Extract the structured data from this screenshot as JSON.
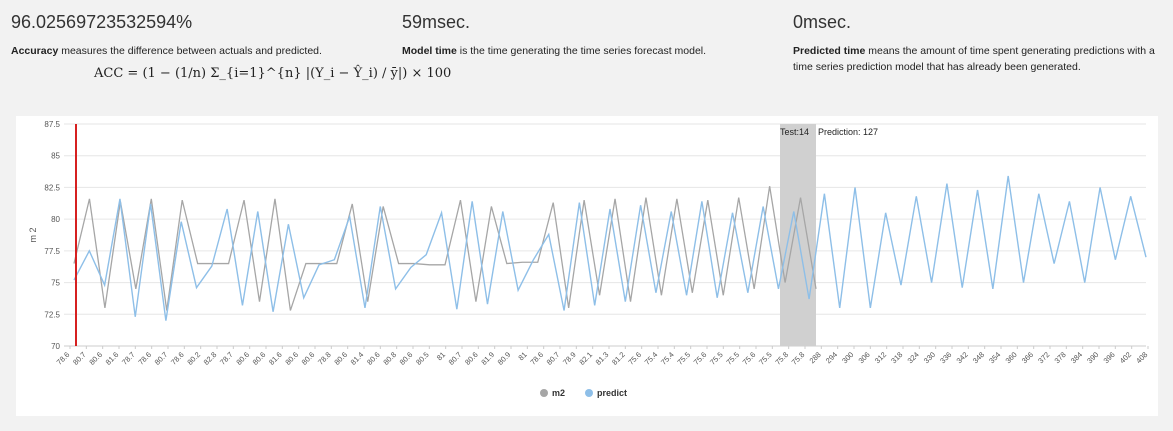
{
  "metrics": {
    "accuracy": {
      "value": "96.02569723532594%",
      "term": "Accuracy",
      "text": " measures the difference between actuals and predicted."
    },
    "model_time": {
      "value": "59msec.",
      "term": "Model time",
      "text": " is the time generating the time series forecast model."
    },
    "predicted_time": {
      "value": "0msec.",
      "term": "Predicted time",
      "text": " means the amount of time spent generating predictions with a time series prediction model that has already been generated."
    }
  },
  "formula": "ACC = (1 − (1/n) Σ_{i=1}^{n} |(Y_i − Ŷ_i) / ȳ|) × 100",
  "colors": {
    "m2": "#a6a6a6",
    "predict": "#8ebfe8",
    "marker": "#d62020",
    "highlight": "#d0d0d0"
  },
  "chart_data": {
    "type": "line",
    "ylabel": "m 2",
    "ylim": [
      70,
      87.5
    ],
    "yticks": [
      "87.5",
      "85",
      "82.5",
      "80",
      "77.5",
      "75",
      "72.5",
      "70"
    ],
    "xtick_labels": [
      "78.6",
      "80.7",
      "80.6",
      "81.6",
      "78.7",
      "78.6",
      "80.7",
      "78.6",
      "80.2",
      "82.8",
      "78.7",
      "80.6",
      "80.6",
      "81.6",
      "80.6",
      "80.6",
      "78.8",
      "80.6",
      "81.4",
      "80.6",
      "80.8",
      "80.6",
      "80.5",
      "81",
      "80.7",
      "80.6",
      "81.9",
      "80.9",
      "81",
      "78.6",
      "80.7",
      "78.9",
      "82.1",
      "81.3",
      "81.2",
      "75.6",
      "75.4",
      "75.4",
      "75.5",
      "75.6",
      "75.5",
      "75.5",
      "75.6",
      "75.5",
      "75.8",
      "75.8",
      "288",
      "294",
      "300",
      "306",
      "312",
      "318",
      "324",
      "330",
      "336",
      "342",
      "348",
      "354",
      "360",
      "366",
      "372",
      "378",
      "384",
      "390",
      "396",
      "402",
      "408"
    ],
    "series": [
      {
        "name": "m2",
        "values": [
          76.5,
          81.6,
          73,
          81.4,
          74.5,
          81.6,
          72.8,
          81.5,
          76.5,
          76.5,
          76.5,
          81.5,
          73.5,
          81.6,
          72.8,
          76.5,
          76.5,
          76.5,
          81.2,
          73.5,
          81.0,
          76.5,
          76.5,
          76.4,
          76.4,
          81.5,
          73.5,
          81.0,
          76.5,
          76.6,
          76.6,
          81.3,
          73.0,
          81.5,
          74.0,
          81.6,
          73.5,
          81.7,
          74.0,
          81.6,
          74.2,
          81.5,
          74.0,
          81.7,
          74.5,
          82.6,
          75.0,
          81.7,
          74.5
        ]
      },
      {
        "name": "predict",
        "values": [
          75.2,
          77.5,
          74.8,
          81.6,
          72.3,
          81.2,
          72.0,
          79.8,
          74.6,
          76.3,
          80.8,
          73.2,
          80.6,
          72.7,
          79.6,
          73.8,
          76.4,
          76.8,
          80.2,
          73.0,
          81.0,
          74.5,
          76.2,
          77.2,
          80.5,
          72.9,
          81.4,
          73.3,
          80.6,
          74.4,
          76.8,
          78.8,
          72.8,
          81.3,
          73.2,
          80.8,
          73.5,
          81.1,
          74.2,
          80.6,
          74.0,
          81.4,
          73.8,
          80.5,
          74.2,
          81.0,
          74.5,
          80.6,
          73.7,
          82.0,
          73.0,
          82.5,
          73.0,
          80.5,
          74.8,
          81.8,
          75.0,
          82.8,
          74.6,
          82.3,
          74.5,
          83.4,
          75.0,
          82.0,
          76.5,
          81.4,
          75.0,
          82.5,
          76.8,
          81.8,
          77.0
        ]
      }
    ],
    "highlight_label_test": "Test:14",
    "highlight_label_pred": "Prediction: 127",
    "legend": [
      "m2",
      "predict"
    ],
    "legend_position": "bottom-center"
  }
}
